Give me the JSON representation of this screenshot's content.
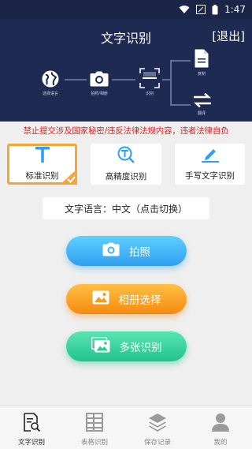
{
  "status_bar": {
    "time": "1:47"
  },
  "header": {
    "title": "文字识别",
    "exit_label": "[退出]"
  },
  "flow": {
    "translate_label": "选择语言",
    "camera_label": "拍照/相册",
    "recognize_label": "识别",
    "copy_label": "复制",
    "flip_label": "翻译"
  },
  "warning": "禁止提交涉及国家秘密/违反法律法规内容，违者法律自负",
  "modes": [
    {
      "label": "标准识别"
    },
    {
      "label": "高精度识别"
    },
    {
      "label": "手写文字识别"
    }
  ],
  "language": {
    "text": "文字语言：中文（点击切换）"
  },
  "actions": {
    "photo": "拍照",
    "album": "相册选择",
    "multi": "多张识别"
  },
  "tabs": [
    {
      "label": "文字识别"
    },
    {
      "label": "表格识别"
    },
    {
      "label": "保存记录"
    },
    {
      "label": "我的"
    }
  ],
  "colors": {
    "header_bg": "#1e2a52",
    "warning": "#e0201e",
    "active_border": "#f4a637",
    "accent_blue": "#2f9ff0"
  }
}
